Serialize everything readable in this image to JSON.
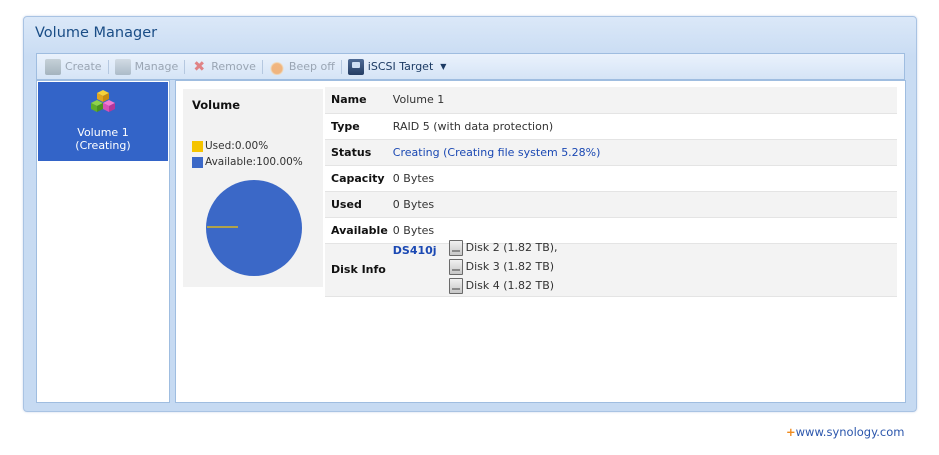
{
  "window": {
    "title": "Volume Manager"
  },
  "toolbar": {
    "create_label": "Create",
    "manage_label": "Manage",
    "remove_label": "Remove",
    "beep_label": "Beep off",
    "iscsi_label": "iSCSI Target"
  },
  "volumes": [
    {
      "name": "Volume 1",
      "status": "(Creating)"
    }
  ],
  "summary": {
    "title": "Volume",
    "used_label": "Used:0.00%",
    "available_label": "Available:100.00%",
    "colors": {
      "used": "#f5c400",
      "available": "#3b68c7"
    }
  },
  "chart_data": {
    "type": "pie",
    "title": "Volume",
    "categories": [
      "Used",
      "Available"
    ],
    "values": [
      0.0,
      100.0
    ],
    "colors": [
      "#f5c400",
      "#3b68c7"
    ]
  },
  "details": {
    "name_key": "Name",
    "name_val": "Volume 1",
    "type_key": "Type",
    "type_val": "RAID 5 (with data protection)",
    "status_key": "Status",
    "status_val_1": "Creating",
    "status_val_2": "(Creating file system 5.28%)",
    "capacity_key": "Capacity",
    "capacity_val": "0 Bytes",
    "used_key": "Used",
    "used_val": "0 Bytes",
    "available_key": "Available",
    "available_val": "0 Bytes",
    "diskinfo_key": "Disk Info",
    "ds_name": "DS410j",
    "disks": [
      {
        "label": "Disk 2 (1.82 TB),"
      },
      {
        "label": "Disk 3 (1.82 TB)"
      },
      {
        "label": "Disk 4 (1.82 TB)"
      }
    ]
  },
  "footer": {
    "plus": "+",
    "link": "www.synology.com"
  }
}
